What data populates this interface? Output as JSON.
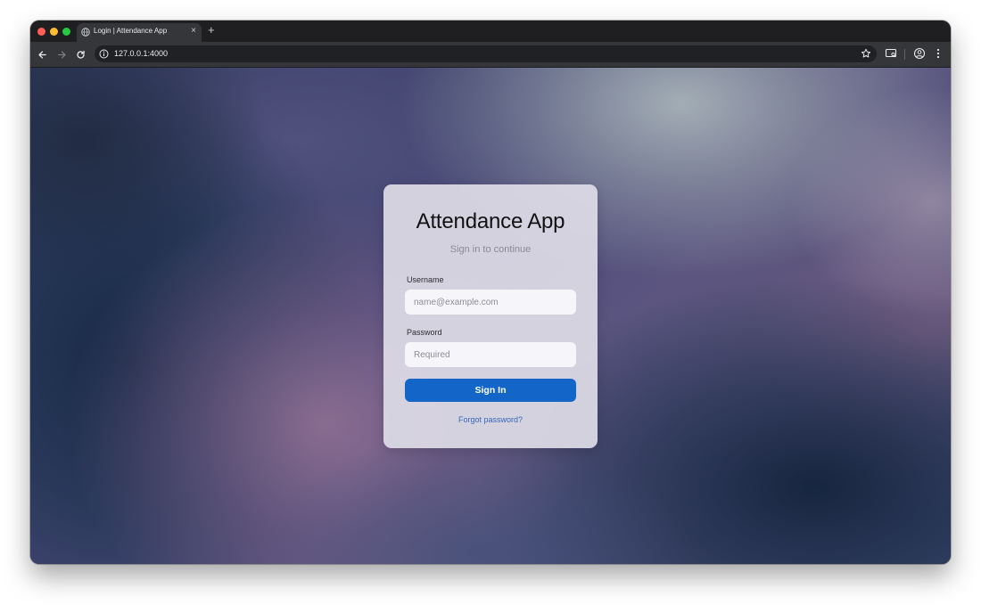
{
  "browser": {
    "tab_title": "Login | Attendance App",
    "tab_close": "×",
    "new_tab": "+",
    "url": "127.0.0.1:4000"
  },
  "login": {
    "title": "Attendance App",
    "subtitle": "Sign in to continue",
    "username_label": "Username",
    "username_placeholder": "name@example.com",
    "username_value": "",
    "password_label": "Password",
    "password_placeholder": "Required",
    "password_value": "",
    "signin_label": "Sign In",
    "forgot_label": "Forgot password?"
  },
  "colors": {
    "primary_button": "#1366c8",
    "link": "#3667b6"
  },
  "icons": {
    "back": "back-arrow-icon",
    "forward": "forward-arrow-icon",
    "reload": "reload-icon",
    "site_info": "info-icon",
    "bookmark": "star-icon",
    "cast": "cast-icon",
    "profile": "profile-icon",
    "menu": "kebab-menu-icon"
  }
}
